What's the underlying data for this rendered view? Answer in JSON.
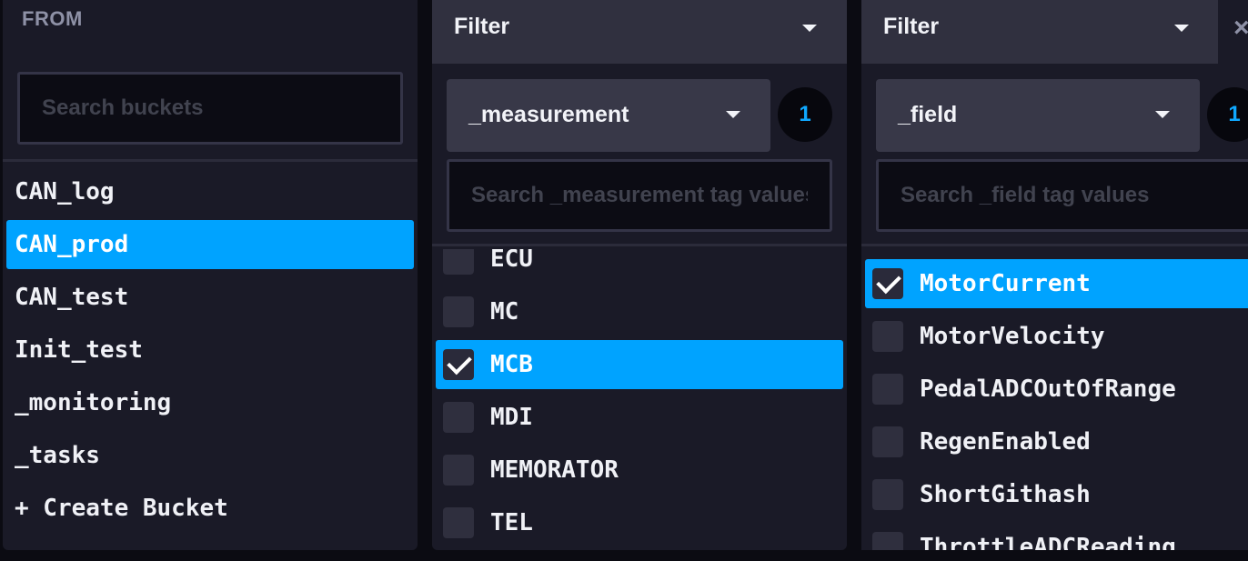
{
  "from_panel": {
    "title": "FROM",
    "search_placeholder": "Search buckets",
    "buckets": [
      {
        "name": "CAN_log",
        "selected": false
      },
      {
        "name": "CAN_prod",
        "selected": true
      },
      {
        "name": "CAN_test",
        "selected": false
      },
      {
        "name": "Init_test",
        "selected": false
      },
      {
        "name": "_monitoring",
        "selected": false
      },
      {
        "name": "_tasks",
        "selected": false
      }
    ],
    "create_label": "+ Create Bucket"
  },
  "measurement_panel": {
    "header": "Filter",
    "key": "_measurement",
    "count": "1",
    "search_placeholder": "Search _measurement tag values",
    "items": [
      {
        "label": "ECU",
        "checked": false
      },
      {
        "label": "MC",
        "checked": false
      },
      {
        "label": "MCB",
        "checked": true
      },
      {
        "label": "MDI",
        "checked": false
      },
      {
        "label": "MEMORATOR",
        "checked": false
      },
      {
        "label": "TEL",
        "checked": false
      }
    ]
  },
  "field_panel": {
    "header": "Filter",
    "key": "_field",
    "count": "1",
    "search_placeholder": "Search _field tag values",
    "items": [
      {
        "label": "MotorCurrent",
        "checked": true
      },
      {
        "label": "MotorVelocity",
        "checked": false
      },
      {
        "label": "PedalADCOutOfRange",
        "checked": false
      },
      {
        "label": "RegenEnabled",
        "checked": false
      },
      {
        "label": "ShortGithash",
        "checked": false
      },
      {
        "label": "ThrottleADCReading",
        "checked": false
      }
    ]
  },
  "colors": {
    "accent": "#00a3ff",
    "panel": "#1a1a27",
    "background": "#0b0b12"
  },
  "icons": {
    "close": "close-icon",
    "dropdown": "chevron-down-icon",
    "check": "check-icon"
  }
}
